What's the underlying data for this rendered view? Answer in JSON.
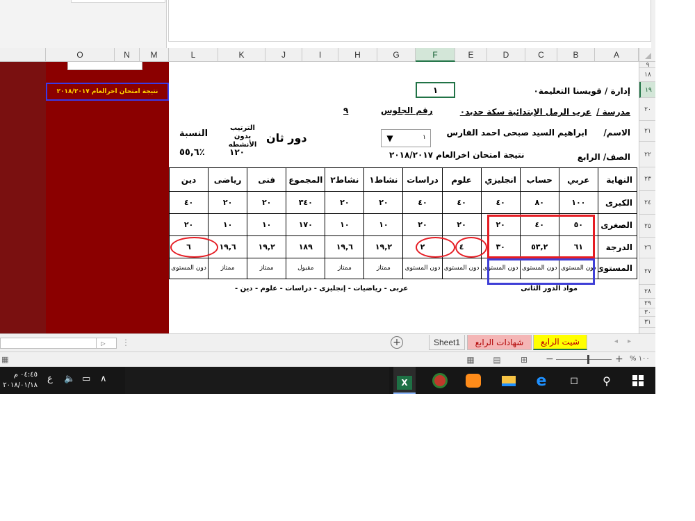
{
  "sheet": {
    "columns": [
      "A",
      "B",
      "C",
      "D",
      "E",
      "F",
      "G",
      "H",
      "I",
      "J",
      "K",
      "L",
      "M",
      "N",
      "O"
    ],
    "selected_column": "F",
    "rows": [
      "٩",
      "١٨",
      "١٩",
      "٢٠",
      "٢١",
      "٢٢",
      "٢٣",
      "٢٤",
      "٢٥",
      "٢٦",
      "٢٧",
      "٢٨",
      "٢٩",
      "٣٠",
      "٣١"
    ],
    "selected_row": "١٩",
    "side_label": "نتيجة امتحان اخرالعام ٢٠١٨/٢٠١٧",
    "admin_line": "إدارة / قويسنا التعليمة٠",
    "f_cell_value": "١",
    "school_label": "مدرسة /",
    "school_name": "عرب الرمل الإبتدائية سكة حديد٠",
    "seat_label": "رقم الجلوس",
    "seat_value": "٩",
    "name_label": "الاسم/",
    "student_name": "ابراهيم السيد صبحى احمد الفارس",
    "dropdown_value": "١",
    "round_label": "دور ثان",
    "grade_label": "الصف/ الرابع",
    "result_title": "نتيجة امتحان اخرالعام ٢٠١٨/٢٠١٧",
    "ranking_label": "الترتيب بدون الأنشطه",
    "ranking_value": "١٢٠",
    "percent_label": "النسبة",
    "percent_value": "٥٥,٦٪",
    "table": {
      "headers": [
        "دين",
        "رياضى",
        "فنى",
        "المجموع",
        "نشاط٢",
        "نشاط١",
        "دراسات",
        "علوم",
        "انجليزي",
        "حساب",
        "عربي",
        "النهاية"
      ],
      "max": [
        "٤٠",
        "٢٠",
        "٢٠",
        "٣٤٠",
        "٢٠",
        "٢٠",
        "٤٠",
        "٤٠",
        "٤٠",
        "٨٠",
        "١٠٠",
        "الكبرى"
      ],
      "min": [
        "٢٠",
        "١٠",
        "١٠",
        "١٧٠",
        "١٠",
        "١٠",
        "٢٠",
        "٢٠",
        "٢٠",
        "٤٠",
        "٥٠",
        "الصغرى"
      ],
      "score": [
        "٦",
        "١٩,٦",
        "١٩,٢",
        "١٨٩",
        "١٩,٦",
        "١٩,٢",
        "٢",
        "٤",
        "٣٠",
        "٥٣,٢",
        "٦١",
        "الدرجة"
      ],
      "level": [
        "دون المستوى",
        "ممتاز",
        "ممتاز",
        "مقبول",
        "ممتاز",
        "ممتاز",
        "دون المستوى",
        "دون المستوى",
        "دون المستوى",
        "دون المستوى",
        "دون المستوى",
        "المستوى"
      ]
    },
    "second_round_label": "مواد الدور الثانى",
    "second_round_subjects": "عربى  -  رياضيات  -  إنجليزى  -  دراسات  -  علوم  -  دين  -"
  },
  "tabs": {
    "sheet1": "Sheet1",
    "certificates": "شهادات الرابع",
    "active": "شيت الرابع",
    "add_symbol": "+"
  },
  "statusbar": {
    "zoom": "١٠٠ %"
  },
  "taskbar": {
    "time": "٠٤:٤٥ م",
    "date": "٢٠١٨/٠١/١٨",
    "lang": "ع"
  },
  "colors": {
    "maroon": "#8b0000",
    "excel_green": "#217346",
    "highlight_red": "#e51c23",
    "highlight_blue": "#3f3fd6",
    "tab_yellow": "#ffff00"
  }
}
